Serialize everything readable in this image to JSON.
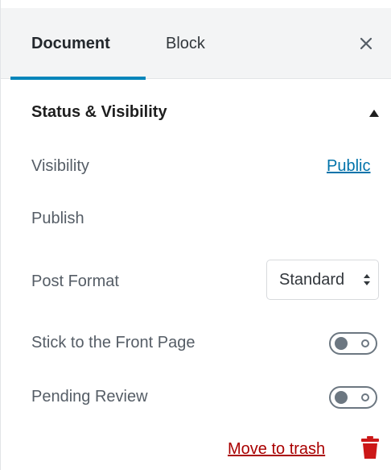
{
  "tabs": {
    "document_label": "Document",
    "block_label": "Block"
  },
  "section": {
    "title": "Status & Visibility"
  },
  "visibility": {
    "label": "Visibility",
    "value": "Public"
  },
  "publish": {
    "label": "Publish"
  },
  "post_format": {
    "label": "Post Format",
    "selected": "Standard"
  },
  "stick_front": {
    "label": "Stick to the Front Page",
    "enabled": false
  },
  "pending_review": {
    "label": "Pending Review",
    "enabled": false
  },
  "trash": {
    "label": "Move to trash"
  },
  "colors": {
    "accent": "#0085ba",
    "link": "#0073aa",
    "danger": "#aa0000"
  },
  "icons": [
    "close-icon",
    "caret-up-icon",
    "select-arrows-icon",
    "trash-icon"
  ]
}
